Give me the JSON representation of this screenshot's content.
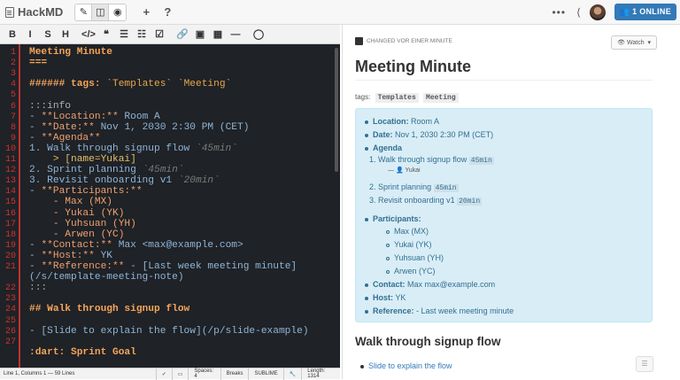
{
  "app": {
    "name": "HackMD"
  },
  "topbar": {
    "plus": "+",
    "help": "?",
    "more": "•••",
    "online": "1 ONLINE"
  },
  "toolbar": [
    "B",
    "I",
    "S",
    "H",
    "</>",
    "❝",
    "☰",
    "☷",
    "☑",
    "🔗",
    "▣",
    "▦",
    "—",
    "◯"
  ],
  "editor": {
    "line_numbers": [
      "1",
      "2",
      "3",
      "4",
      "5",
      "6",
      "7",
      "8",
      "9",
      "10",
      "11",
      "12",
      "13",
      "14",
      "15",
      "16",
      "17",
      "18",
      "19",
      "20",
      "21",
      "",
      "22",
      "23",
      "24",
      "25",
      "26",
      "27"
    ],
    "lines": [
      {
        "segs": [
          {
            "t": "Meeting Minute",
            "c": "c-head"
          }
        ]
      },
      {
        "segs": [
          {
            "t": "===",
            "c": "c-head"
          }
        ]
      },
      {
        "segs": [
          {
            "t": "",
            "c": ""
          }
        ]
      },
      {
        "segs": [
          {
            "t": "###### tags: ",
            "c": "c-head"
          },
          {
            "t": "`Templates`",
            "c": "c-str"
          },
          {
            "t": " ",
            "c": ""
          },
          {
            "t": "`Meeting`",
            "c": "c-str"
          }
        ]
      },
      {
        "segs": [
          {
            "t": "",
            "c": ""
          }
        ]
      },
      {
        "segs": [
          {
            "t": ":::info",
            "c": "c-grey2"
          }
        ]
      },
      {
        "segs": [
          {
            "t": "- ",
            "c": "c-list"
          },
          {
            "t": "**Location:**",
            "c": "c-bold"
          },
          {
            "t": " Room A",
            "c": "c-list"
          }
        ]
      },
      {
        "segs": [
          {
            "t": "- ",
            "c": "c-list"
          },
          {
            "t": "**Date:**",
            "c": "c-bold"
          },
          {
            "t": " Nov 1, 2030 2:30 PM (CET)",
            "c": "c-list"
          }
        ]
      },
      {
        "segs": [
          {
            "t": "- ",
            "c": "c-list"
          },
          {
            "t": "**Agenda**",
            "c": "c-bold"
          }
        ]
      },
      {
        "segs": [
          {
            "t": "1. Walk through signup flow ",
            "c": "c-list"
          },
          {
            "t": "`45min`",
            "c": "c-grey"
          }
        ]
      },
      {
        "segs": [
          {
            "t": "    > [name=Yukai]",
            "c": "c-str2"
          }
        ]
      },
      {
        "segs": [
          {
            "t": "2. Sprint planning ",
            "c": "c-list"
          },
          {
            "t": "`45min`",
            "c": "c-grey"
          }
        ]
      },
      {
        "segs": [
          {
            "t": "3. Revisit onboarding v1 ",
            "c": "c-list"
          },
          {
            "t": "`20min`",
            "c": "c-grey"
          }
        ]
      },
      {
        "segs": [
          {
            "t": "- ",
            "c": "c-list"
          },
          {
            "t": "**Participants:**",
            "c": "c-bold"
          }
        ]
      },
      {
        "segs": [
          {
            "t": "    - Max (MX)",
            "c": "c-bold"
          }
        ]
      },
      {
        "segs": [
          {
            "t": "    - Yukai (YK)",
            "c": "c-bold"
          }
        ]
      },
      {
        "segs": [
          {
            "t": "    - Yuhsuan (YH)",
            "c": "c-bold"
          }
        ]
      },
      {
        "segs": [
          {
            "t": "    - Arwen (YC)",
            "c": "c-bold"
          }
        ]
      },
      {
        "segs": [
          {
            "t": "- ",
            "c": "c-list"
          },
          {
            "t": "**Contact:**",
            "c": "c-bold"
          },
          {
            "t": " Max <max@example.com>",
            "c": "c-list"
          }
        ]
      },
      {
        "segs": [
          {
            "t": "- ",
            "c": "c-list"
          },
          {
            "t": "**Host:**",
            "c": "c-bold"
          },
          {
            "t": " YK",
            "c": "c-list"
          }
        ]
      },
      {
        "segs": [
          {
            "t": "- ",
            "c": "c-list"
          },
          {
            "t": "**Reference:**",
            "c": "c-bold"
          },
          {
            "t": " - [Last week meeting minute]",
            "c": "c-list"
          }
        ]
      },
      {
        "segs": [
          {
            "t": "(/s/template-meeting-note)",
            "c": "c-list"
          }
        ]
      },
      {
        "segs": [
          {
            "t": ":::",
            "c": "c-grey2"
          }
        ]
      },
      {
        "segs": [
          {
            "t": "",
            "c": ""
          }
        ]
      },
      {
        "segs": [
          {
            "t": "## Walk through signup flow",
            "c": "c-head"
          }
        ]
      },
      {
        "segs": [
          {
            "t": "",
            "c": ""
          }
        ]
      },
      {
        "segs": [
          {
            "t": "- [Slide to explain the flow](/p/slide-example)",
            "c": "c-list"
          }
        ]
      },
      {
        "segs": [
          {
            "t": "",
            "c": ""
          }
        ]
      },
      {
        "segs": [
          {
            "t": ":dart: Sprint Goal",
            "c": "c-head"
          }
        ]
      }
    ]
  },
  "status": {
    "left": "Line 1, Columns 1 — 59 Lines",
    "spaces": "Spaces: 4",
    "breaks": "Breaks",
    "keymap": "SUBLIME",
    "length": "Length: 1314"
  },
  "preview": {
    "changed": "CHANGED VOR EINER MINUTE",
    "watch": "Watch",
    "title": "Meeting Minute",
    "tags_label": "tags:",
    "tags": [
      "Templates",
      "Meeting"
    ],
    "info": {
      "location_label": "Location:",
      "location": " Room A",
      "date_label": "Date:",
      "date": " Nov 1, 2030 2:30 PM (CET)",
      "agenda_label": "Agenda",
      "agenda": [
        {
          "n": "1.",
          "text": "Walk through signup flow",
          "time": "45min"
        },
        {
          "n": "2.",
          "text": "Sprint planning",
          "time": "45min"
        },
        {
          "n": "3.",
          "text": "Revisit onboarding v1",
          "time": "20min"
        }
      ],
      "yukai_note": "— 👤 Yukai",
      "participants_label": "Participants:",
      "participants": [
        "Max (MX)",
        "Yukai (YK)",
        "Yuhsuan (YH)",
        "Arwen (YC)"
      ],
      "contact_label": "Contact:",
      "contact": " Max max@example.com",
      "host_label": "Host:",
      "host": " YK",
      "reference_label": "Reference:",
      "reference": " - Last week meeting minute"
    },
    "h2": "Walk through signup flow",
    "slide": "Slide to explain the flow"
  }
}
